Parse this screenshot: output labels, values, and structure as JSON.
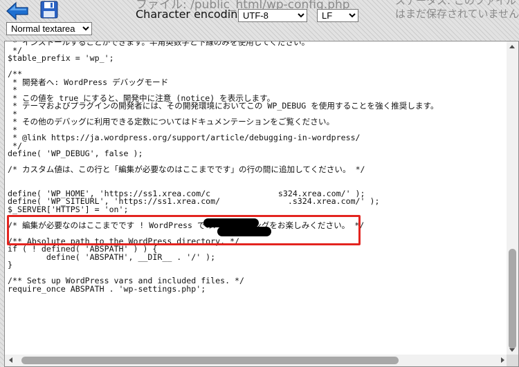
{
  "toolbar": {
    "back_icon": "back-arrow-icon",
    "save_icon": "floppy-disk-icon",
    "file_label": "ファイル: /public_html/wp-config.php",
    "encoding_label": "Character encoding:",
    "encoding_selected": "UTF-8",
    "line_ending_selected": "LF",
    "status_line1": "ステータス: このファイル",
    "status_line2": "はまだ保存されていません",
    "mode_selected": "Normal textarea",
    "back_color": "#1e6fd0",
    "save_color": "#2b63c4"
  },
  "editor": {
    "lines": [
      " * インストールすることができます。半角英数字と下線のみを使用してください。",
      " */",
      "$table_prefix = 'wp_';",
      "",
      "/**",
      " * 開発者へ: WordPress デバッグモード",
      " *",
      " * この値を true にすると、開発中に注意 (notice) を表示します。",
      " * テーマおよびプラグインの開発者には、その開発環境においてこの WP_DEBUG を使用することを強く推奨します。",
      " *",
      " * その他のデバッグに利用できる定数についてはドキュメンテーションをご覧ください。",
      " *",
      " * @link https://ja.wordpress.org/support/article/debugging-in-wordpress/",
      " */",
      "define( 'WP_DEBUG', false );",
      "",
      "/* カスタム値は、この行と「編集が必要なのはここまでです」の行の間に追加してください。 */",
      "",
      "",
      "define( 'WP_HOME', 'https://ss1.xrea.com/c              s324.xrea.com/' );",
      "define( 'WP_SITEURL', 'https://ss1.xrea.com/              .s324.xrea.com/' );",
      "$_SERVER['HTTPS'] = 'on';",
      "",
      "/* 編集が必要なのはここまでです ! WordPress でのパブリッシングをお楽しみください。 */",
      "",
      "/** Absolute path to the WordPress directory. */",
      "if ( ! defined( 'ABSPATH' ) ) {",
      "\tdefine( 'ABSPATH', __DIR__ . '/' );",
      "}",
      "",
      "/** Sets up WordPress vars and included files. */",
      "require_once ABSPATH . 'wp-settings.php';"
    ],
    "highlight_color": "#e3241f"
  }
}
